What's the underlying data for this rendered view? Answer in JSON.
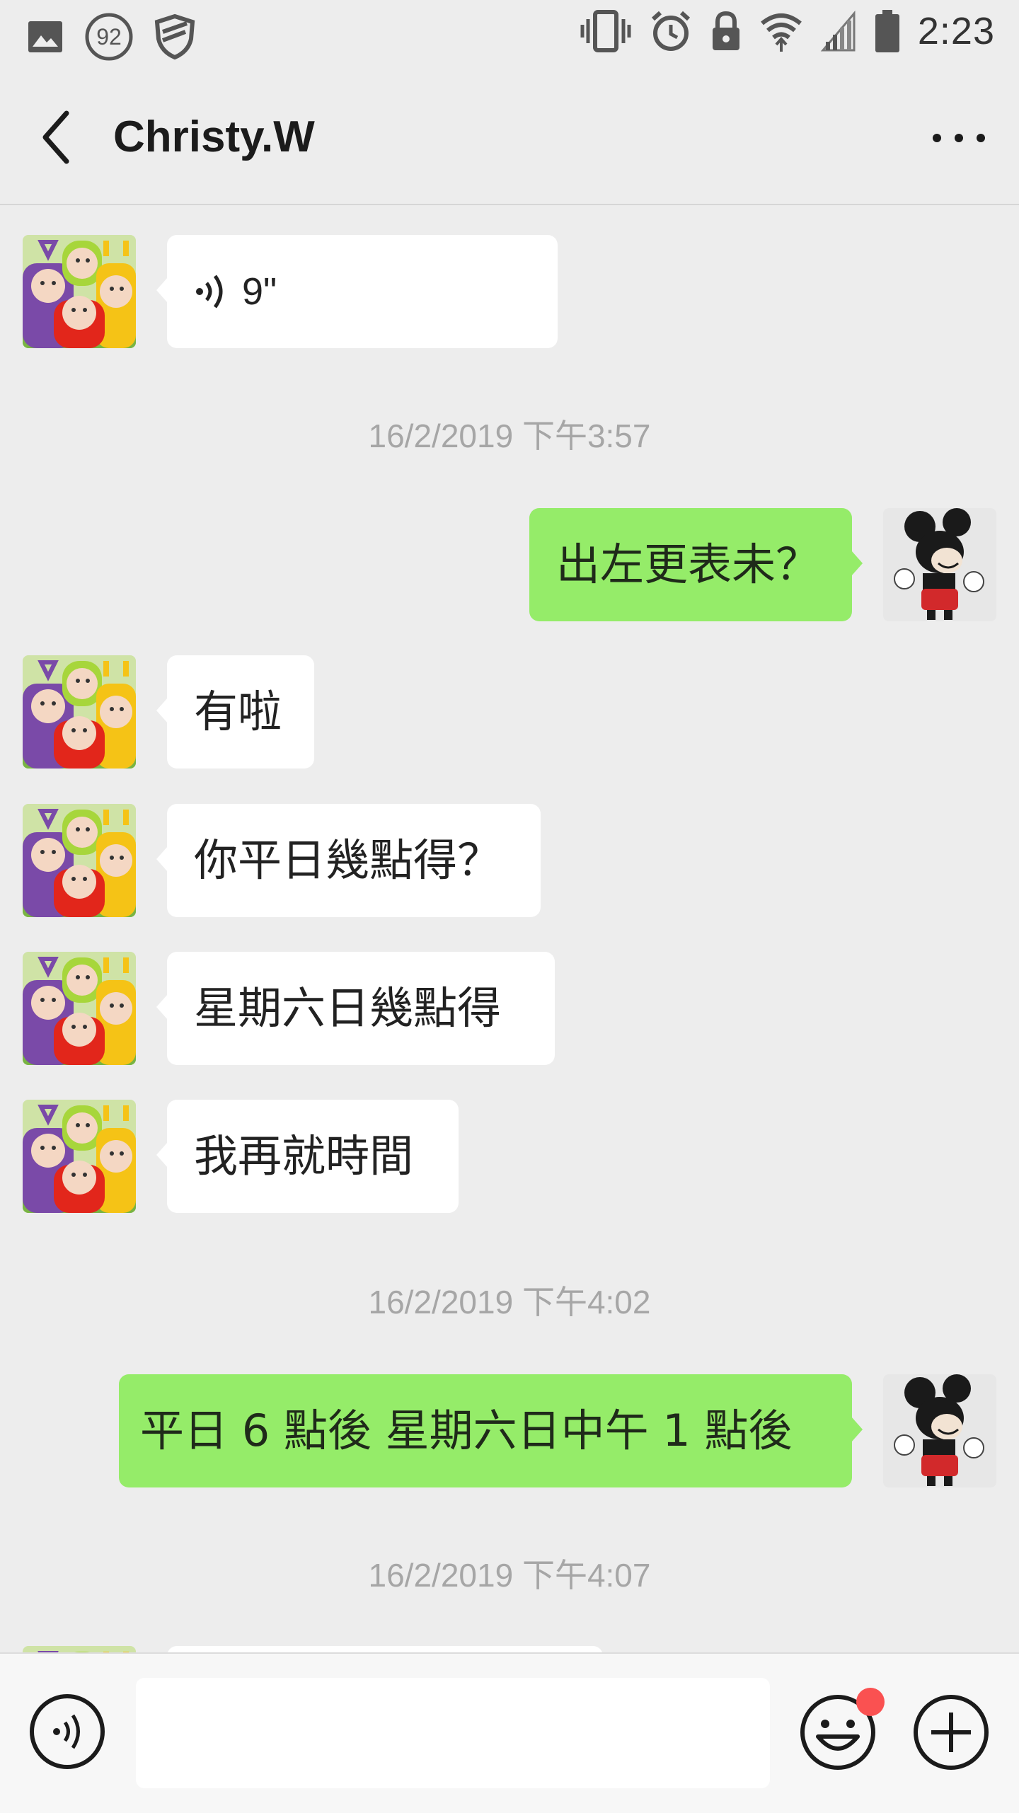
{
  "status_bar": {
    "time": "2:23",
    "notification_count": "92",
    "left_icons": [
      "image-icon",
      "notification-count-icon",
      "shield-icon"
    ],
    "right_icons": [
      "vibrate-icon",
      "alarm-icon",
      "lock-icon",
      "wifi-icon",
      "signal-icon",
      "battery-icon"
    ]
  },
  "header": {
    "title": "Christy.W",
    "back_icon": "chevron-left-icon",
    "more_icon": "more-dots-icon"
  },
  "messages": [
    {
      "side": "in",
      "type": "voice",
      "duration": "9\""
    },
    {
      "type": "timestamp",
      "text": "16/2/2019 下午3:57"
    },
    {
      "side": "out",
      "type": "text",
      "text": "出左更表未？"
    },
    {
      "side": "in",
      "type": "text",
      "text": "有啦"
    },
    {
      "side": "in",
      "type": "text",
      "text": "你平日幾點得？"
    },
    {
      "side": "in",
      "type": "text",
      "text": "星期六日幾點得"
    },
    {
      "side": "in",
      "type": "text",
      "text": "我再就時間"
    },
    {
      "type": "timestamp",
      "text": "16/2/2019 下午4:02"
    },
    {
      "side": "out",
      "type": "text",
      "text": "平日 6 點後 星期六日中午 1 點後"
    },
    {
      "type": "timestamp",
      "text": "16/2/2019 下午4:07"
    }
  ],
  "input_bar": {
    "voice_icon": "voice-input-icon",
    "emoji_icon": "emoji-icon",
    "plus_icon": "plus-icon",
    "input_value": ""
  },
  "colors": {
    "background": "#ededed",
    "bubble_in": "#ffffff",
    "bubble_out": "#95ec69",
    "timestamp_text": "#a6a6a6",
    "badge_dot": "#fa5151"
  }
}
